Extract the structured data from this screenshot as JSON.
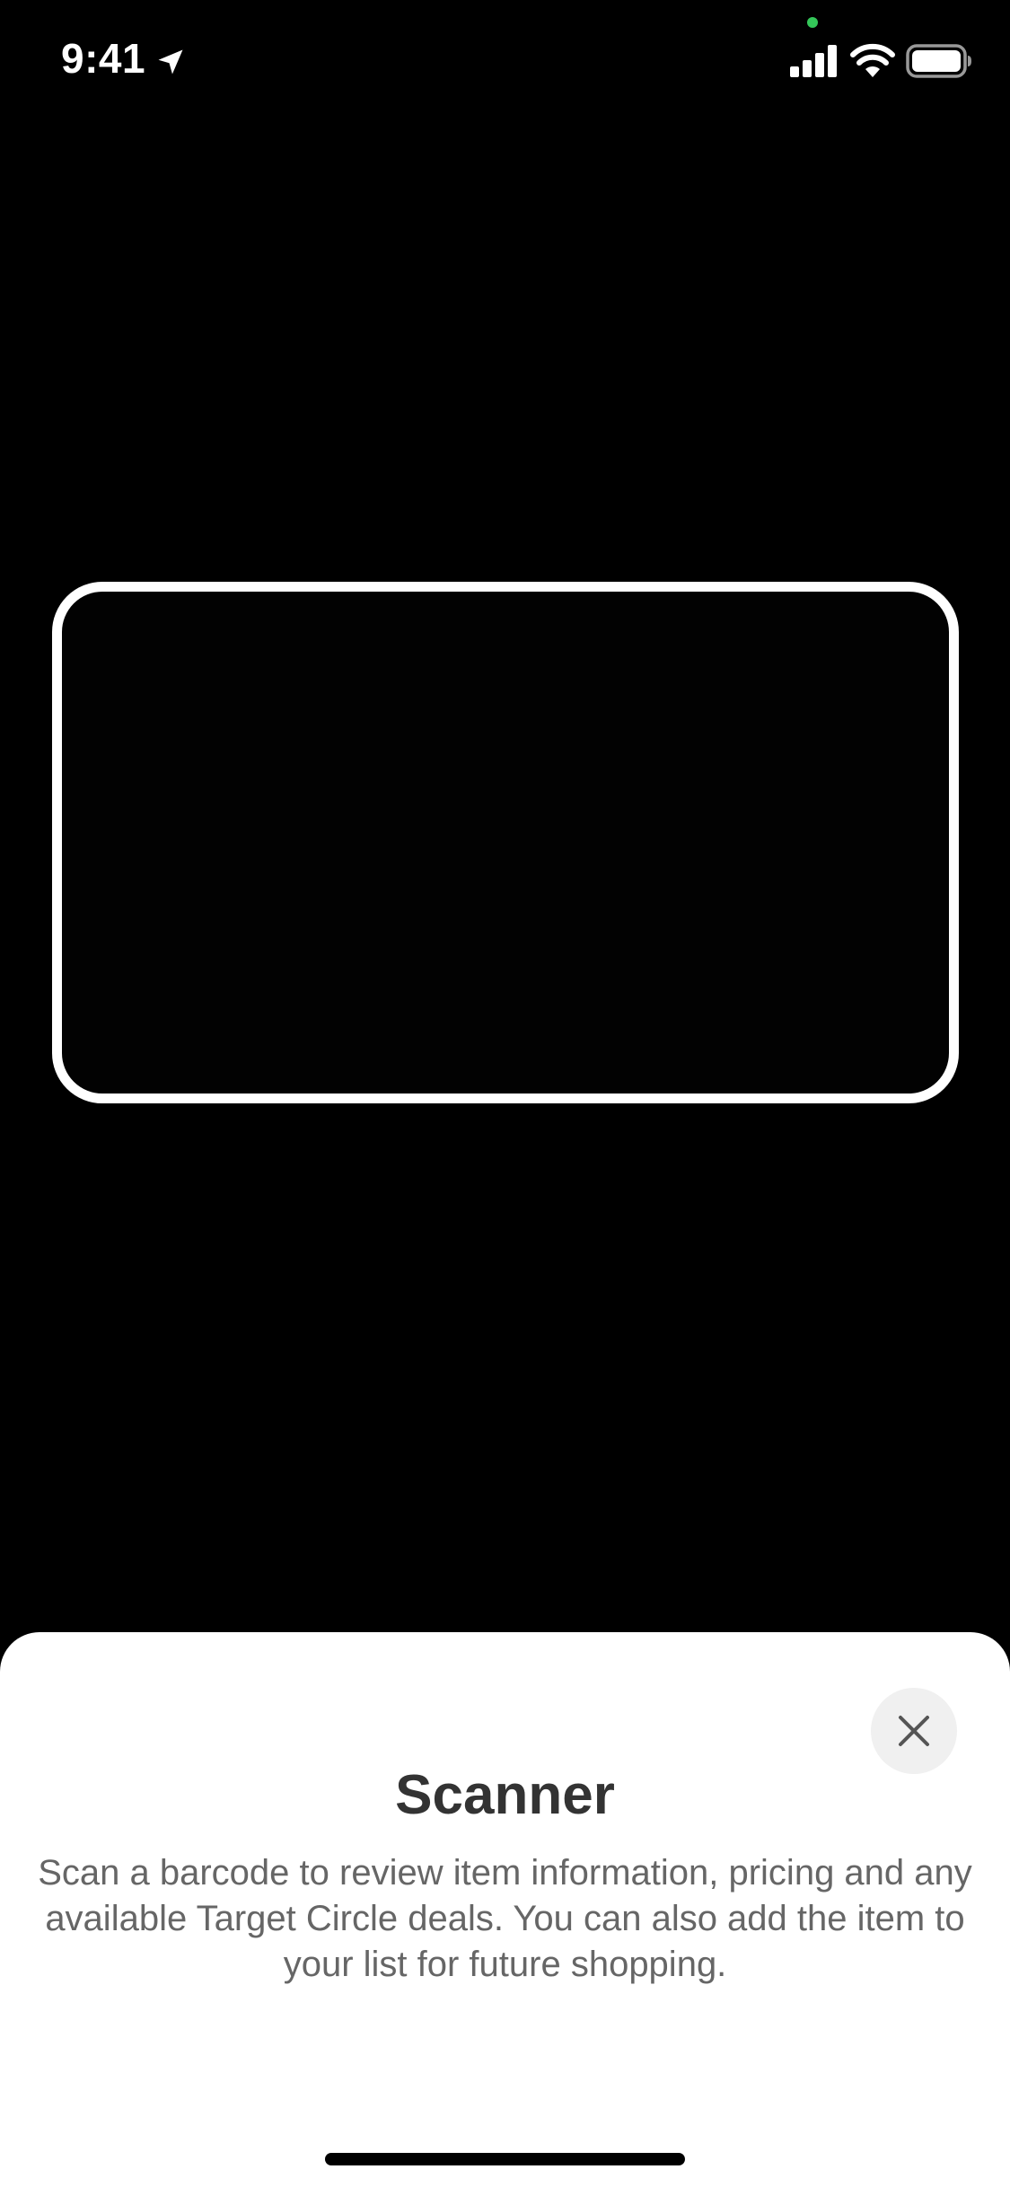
{
  "status_bar": {
    "time": "9:41",
    "icons": [
      "location-arrow-icon",
      "signal-icon",
      "wifi-icon",
      "battery-icon"
    ],
    "privacy_indicator_color": "#34c759"
  },
  "scanner": {
    "frame_color": "#ffffff",
    "background_color": "#000000"
  },
  "sheet": {
    "title": "Scanner",
    "description": "Scan a barcode to review item information, pricing and any available Target Circle deals. You can also add the item to your list for future shopping.",
    "close_icon": "close-icon"
  }
}
